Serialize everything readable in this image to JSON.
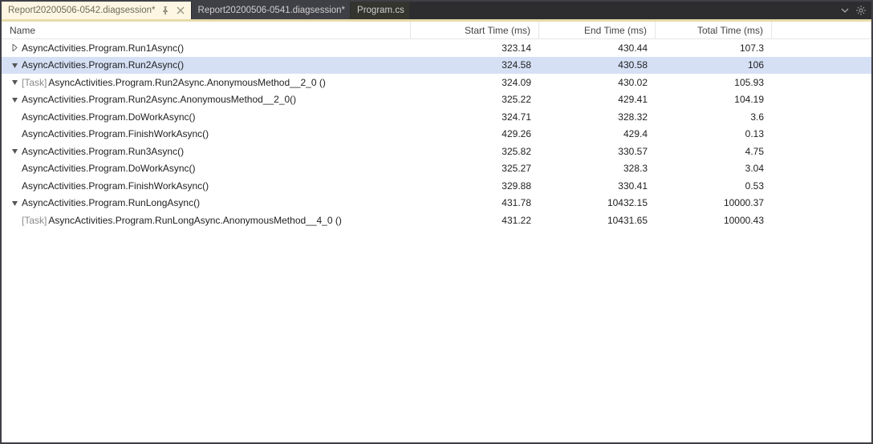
{
  "tabs": [
    {
      "label": "Report20200506-0542.diagsession*",
      "active": true,
      "pinned": true,
      "closable": true
    },
    {
      "label": "Report20200506-0541.diagsession*",
      "active": false,
      "pinned": false,
      "closable": false
    },
    {
      "label": "Program.cs",
      "active": false,
      "pinned": false,
      "closable": false
    }
  ],
  "columns": {
    "name": "Name",
    "start": "Start Time (ms)",
    "end": "End Time (ms)",
    "total": "Total Time (ms)"
  },
  "rows": [
    {
      "indent": 0,
      "expander": "collapsed",
      "selected": false,
      "taskPrefix": "",
      "name": "AsyncActivities.Program.Run1Async()",
      "start": "323.14",
      "end": "430.44",
      "total": "107.3"
    },
    {
      "indent": 0,
      "expander": "expanded",
      "selected": true,
      "taskPrefix": "",
      "name": "AsyncActivities.Program.Run2Async()",
      "start": "324.58",
      "end": "430.58",
      "total": "106"
    },
    {
      "indent": 1,
      "expander": "expanded",
      "selected": false,
      "taskPrefix": "[Task] ",
      "name": "AsyncActivities.Program.Run2Async.AnonymousMethod__2_0 ()",
      "start": "324.09",
      "end": "430.02",
      "total": "105.93"
    },
    {
      "indent": 2,
      "expander": "expanded",
      "selected": false,
      "taskPrefix": "",
      "name": "AsyncActivities.Program.Run2Async.AnonymousMethod__2_0()",
      "start": "325.22",
      "end": "429.41",
      "total": "104.19"
    },
    {
      "indent": 3,
      "expander": "none",
      "selected": false,
      "taskPrefix": "",
      "name": "AsyncActivities.Program.DoWorkAsync()",
      "start": "324.71",
      "end": "328.32",
      "total": "3.6"
    },
    {
      "indent": 3,
      "expander": "none",
      "selected": false,
      "taskPrefix": "",
      "name": "AsyncActivities.Program.FinishWorkAsync()",
      "start": "429.26",
      "end": "429.4",
      "total": "0.13"
    },
    {
      "indent": 0,
      "expander": "expanded",
      "selected": false,
      "taskPrefix": "",
      "name": "AsyncActivities.Program.Run3Async()",
      "start": "325.82",
      "end": "330.57",
      "total": "4.75"
    },
    {
      "indent": 1,
      "expander": "none",
      "selected": false,
      "taskPrefix": "",
      "name": "AsyncActivities.Program.DoWorkAsync()",
      "start": "325.27",
      "end": "328.3",
      "total": "3.04"
    },
    {
      "indent": 1,
      "expander": "none",
      "selected": false,
      "taskPrefix": "",
      "name": "AsyncActivities.Program.FinishWorkAsync()",
      "start": "329.88",
      "end": "330.41",
      "total": "0.53"
    },
    {
      "indent": 0,
      "expander": "expanded",
      "selected": false,
      "taskPrefix": "",
      "name": "AsyncActivities.Program.RunLongAsync()",
      "start": "431.78",
      "end": "10432.15",
      "total": "10000.37"
    },
    {
      "indent": 1,
      "expander": "none",
      "selected": false,
      "taskPrefix": "[Task] ",
      "name": "AsyncActivities.Program.RunLongAsync.AnonymousMethod__4_0 ()",
      "start": "431.22",
      "end": "10431.65",
      "total": "10000.43"
    }
  ]
}
